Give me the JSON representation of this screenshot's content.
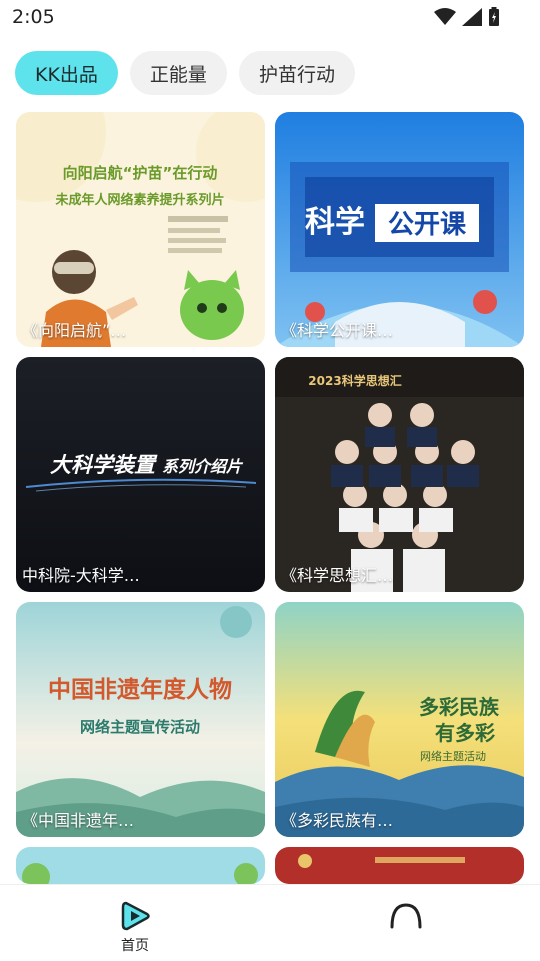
{
  "status": {
    "time": "2:05"
  },
  "tabs": [
    {
      "label": "KK出品",
      "active": true
    },
    {
      "label": "正能量",
      "active": false
    },
    {
      "label": "护苗行动",
      "active": false
    }
  ],
  "cards": [
    {
      "caption": "《向阳启航”…",
      "art_title_1": "向阳启航“护苗”在行动",
      "art_title_2": "未成年人网络素养提升系列片"
    },
    {
      "caption": "《科学公开课…",
      "art_title_1": "科学",
      "art_title_2": "公开课"
    },
    {
      "caption": "中科院-大科学…",
      "art_title_1": "大科学装置",
      "art_title_2": "系列介绍片"
    },
    {
      "caption": "《科学思想汇…",
      "art_title_1": "2023科学思想汇"
    },
    {
      "caption": "《中国非遗年…",
      "art_title_1": "中国非遗年度人物",
      "art_title_2": "网络主题宣传活动"
    },
    {
      "caption": "《多彩民族有…",
      "art_title_1": "多彩民族",
      "art_title_2": "有多彩",
      "art_title_3": "网络主题活动"
    }
  ],
  "bottom_nav": {
    "home_label": "首页"
  },
  "colors": {
    "accent": "#5ee3ec"
  },
  "icons": [
    "wifi-icon",
    "signal-icon",
    "battery-icon",
    "home-play-icon",
    "profile-icon"
  ]
}
